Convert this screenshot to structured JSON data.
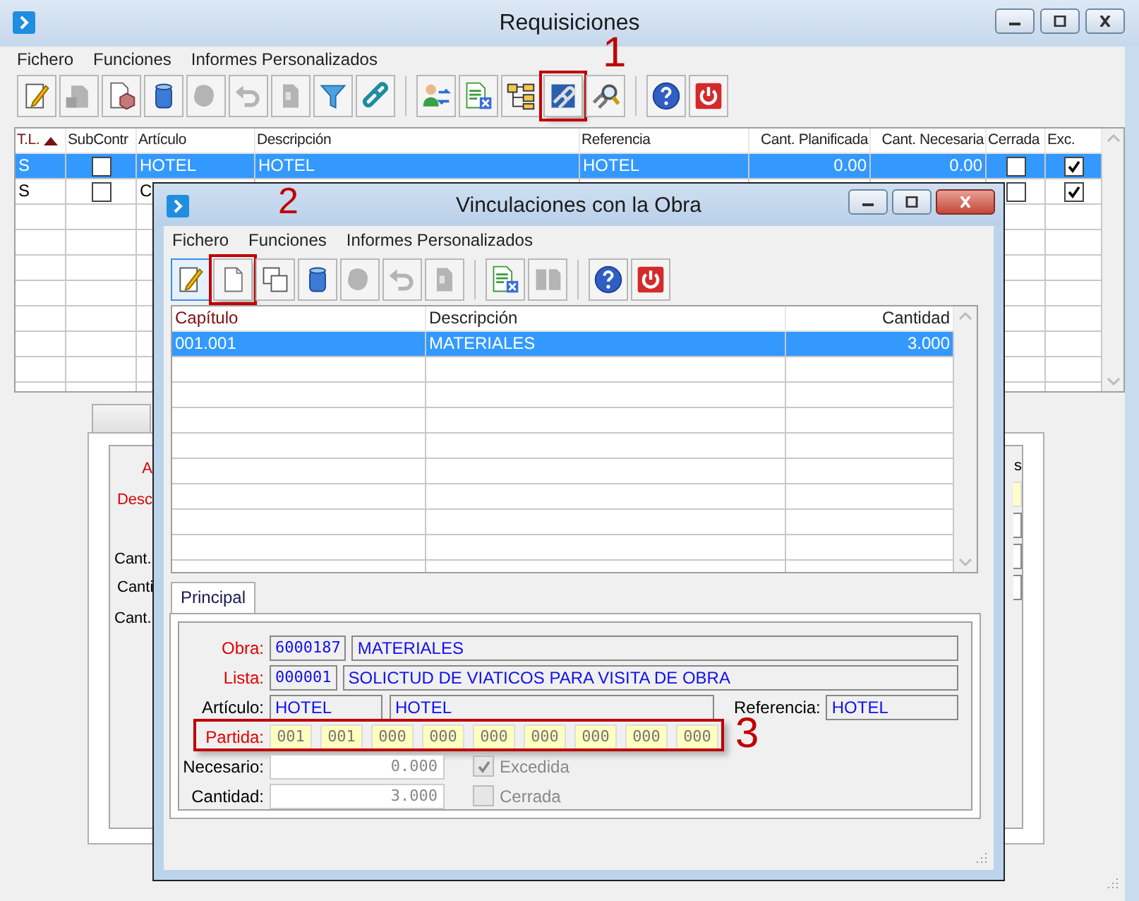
{
  "main_window": {
    "title": "Requisiciones",
    "menu": [
      "Fichero",
      "Funciones",
      "Informes Personalizados"
    ],
    "toolbar": [
      [
        {
          "kind": "edit",
          "disabled": false,
          "pressed": false
        },
        {
          "kind": "stamp",
          "disabled": true,
          "pressed": false
        },
        {
          "kind": "page-box",
          "disabled": false,
          "pressed": false
        },
        {
          "kind": "trash",
          "disabled": false,
          "pressed": false
        },
        {
          "kind": "blob",
          "disabled": true,
          "pressed": false
        },
        {
          "kind": "undo",
          "disabled": true,
          "pressed": false
        },
        {
          "kind": "page",
          "disabled": true,
          "pressed": false
        },
        {
          "kind": "funnel",
          "disabled": false,
          "pressed": false
        },
        {
          "kind": "chain",
          "disabled": false,
          "pressed": false
        }
      ],
      [
        {
          "kind": "user-sync",
          "disabled": false,
          "pressed": false
        },
        {
          "kind": "page-x",
          "disabled": false,
          "pressed": false
        },
        {
          "kind": "tree",
          "disabled": false,
          "pressed": false
        },
        {
          "kind": "link-page",
          "disabled": false,
          "pressed": false,
          "annotation": "1"
        },
        {
          "kind": "link-search",
          "disabled": false,
          "pressed": false
        }
      ],
      [
        {
          "kind": "help",
          "disabled": false,
          "pressed": false
        },
        {
          "kind": "power",
          "disabled": false,
          "pressed": false
        }
      ]
    ],
    "table": {
      "columns": [
        {
          "label": "T.L.",
          "kind": "text",
          "sorted": true
        },
        {
          "label": "SubContr",
          "kind": "check",
          "sorted": false
        },
        {
          "label": "Artículo",
          "kind": "text",
          "sorted": false
        },
        {
          "label": "Descripción",
          "kind": "text",
          "sorted": false
        },
        {
          "label": "Referencia",
          "kind": "text",
          "sorted": false
        },
        {
          "label": "Cant. Planificada",
          "kind": "number",
          "sorted": false
        },
        {
          "label": "Cant. Necesaria",
          "kind": "number",
          "sorted": false
        },
        {
          "label": "Cerrada",
          "kind": "check",
          "sorted": false
        },
        {
          "label": "Exc.",
          "kind": "check",
          "sorted": false
        }
      ],
      "rows": [
        {
          "tl": "S",
          "subcontr": false,
          "articulo": "HOTEL",
          "descripcion": "HOTEL",
          "referencia": "HOTEL",
          "cant_planificada": "0.00",
          "cant_necesaria": "0.00",
          "cerrada": false,
          "exc": true,
          "selected": true
        },
        {
          "tl": "S",
          "subcontr": false,
          "articulo": "C",
          "cerrada": false,
          "exc": true,
          "selected": false
        }
      ]
    },
    "detail_panel": {
      "labels": [
        {
          "text": "A",
          "required": true
        },
        {
          "text": "Desc",
          "required": true
        },
        {
          "text": "Cant.",
          "required": false
        },
        {
          "text": "Canti",
          "required": false
        },
        {
          "text": "Cant.",
          "required": false
        }
      ],
      "right_label": "s"
    }
  },
  "dialog": {
    "title": "Vinculaciones con la Obra",
    "menu": [
      "Fichero",
      "Funciones",
      "Informes Personalizados"
    ],
    "toolbar": [
      [
        {
          "kind": "edit",
          "disabled": false,
          "pressed": true
        },
        {
          "kind": "new-page",
          "disabled": false,
          "pressed": false,
          "annotation": "2"
        },
        {
          "kind": "copy",
          "disabled": false,
          "pressed": false
        },
        {
          "kind": "trash",
          "disabled": false,
          "pressed": false
        },
        {
          "kind": "blob",
          "disabled": true,
          "pressed": false
        },
        {
          "kind": "undo",
          "disabled": true,
          "pressed": false
        },
        {
          "kind": "page",
          "disabled": true,
          "pressed": false
        }
      ],
      [
        {
          "kind": "page-x",
          "disabled": false,
          "pressed": false
        },
        {
          "kind": "split",
          "disabled": true,
          "pressed": false
        }
      ],
      [
        {
          "kind": "help",
          "disabled": false,
          "pressed": false
        },
        {
          "kind": "power",
          "disabled": false,
          "pressed": false
        }
      ]
    ],
    "table": {
      "columns": [
        {
          "label": "Capítulo",
          "kind": "text",
          "sorted": true
        },
        {
          "label": "Descripción",
          "kind": "text",
          "sorted": false
        },
        {
          "label": "Cantidad",
          "kind": "number",
          "sorted": false
        }
      ],
      "rows": [
        {
          "capitulo": "001.001",
          "descripcion": "MATERIALES",
          "cantidad": "3.000",
          "selected": true
        }
      ]
    },
    "tabs": [
      {
        "label": "Principal",
        "selected": true
      }
    ],
    "form": [
      {
        "kind": "code-name",
        "label": "Obra:",
        "required": true,
        "code": "6000187",
        "name": "MATERIALES"
      },
      {
        "kind": "code-name",
        "label": "Lista:",
        "required": true,
        "code": "000001",
        "name": "SOLICTUD DE VIATICOS PARA VISITA DE OBRA"
      },
      {
        "kind": "article",
        "label": "Artículo:",
        "required": false,
        "code": "HOTEL",
        "name": "HOTEL",
        "ref_label": "Referencia:",
        "ref_value": "HOTEL"
      },
      {
        "kind": "segments",
        "label": "Partida:",
        "required": true,
        "segments": [
          "001",
          "001",
          "000",
          "000",
          "000",
          "000",
          "000",
          "000",
          "000"
        ],
        "annotation": "3"
      },
      {
        "kind": "quantity",
        "label": "Necesario:",
        "required": false,
        "value": "0.000",
        "check_label": "Excedida",
        "checked": true,
        "disabled": true
      },
      {
        "kind": "quantity",
        "label": "Cantidad:",
        "required": false,
        "value": "3.000",
        "check_label": "Cerrada",
        "checked": false,
        "disabled": true
      }
    ]
  }
}
